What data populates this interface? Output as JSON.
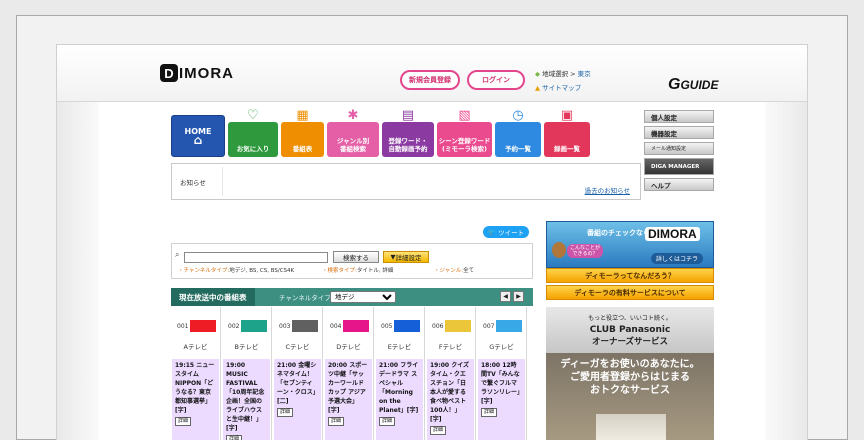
{
  "header": {
    "logo_text": "IMORA",
    "logo_d": "D",
    "signup_label": "新規会員登録",
    "login_label": "ログイン",
    "region_prefix": "地域選択 >",
    "region_value": "東京",
    "sitemap_label": "サイトマップ",
    "gguide_text": "GUIDE"
  },
  "nav": {
    "home": "HOME",
    "tabs": [
      {
        "label": "お気に入り",
        "color": "#2e9a3d"
      },
      {
        "label": "番組表",
        "color": "#ee8e00"
      },
      {
        "label": "ジャンル別\n番組検索",
        "color": "#e55fa6"
      },
      {
        "label": "登録ワード・\n自動録画予約",
        "color": "#8a3aa0"
      },
      {
        "label": "シーン登録ワード\n(ミモーラ検索)",
        "color": "#ea4a8e"
      },
      {
        "label": "予約一覧",
        "color": "#2e8ae0"
      },
      {
        "label": "録画一覧",
        "color": "#e2365a"
      }
    ],
    "right_buttons": [
      "個人設定",
      "機器設定",
      "メール通知設定",
      "DIGA MANAGER",
      "ヘルプ"
    ]
  },
  "news": {
    "label": "お知らせ",
    "past_link": "過去のお知らせ"
  },
  "tweet_label": "ツイート",
  "search": {
    "search_button": "検索する",
    "advanced_button": "詳細設定",
    "channel_type_label": "・チャンネルタイプ:",
    "channel_type_value": "地デジ, BS, CS, BS/CS4K",
    "search_type_label": "・検索タイプ:",
    "search_type_value": "タイトル, 詳細",
    "genre_label": "・ジャンル:",
    "genre_value": "全て"
  },
  "onair": {
    "title": "現在放送中の番組表",
    "channel_type_label": "チャンネルタイプ:",
    "channel_type_selected": "地デジ"
  },
  "channels": [
    {
      "num": "001",
      "name": "Aテレビ",
      "color": "#ee1c24",
      "program": "19:15 ニュースタイム NIPPON「どうなる？東京都知事選挙」[字]"
    },
    {
      "num": "002",
      "name": "Bテレビ",
      "color": "#1da38a",
      "program": "19:00 MUSIC FASTIVAL「10周年記念企画！全国のライブハウスと生中継！」[字]"
    },
    {
      "num": "003",
      "name": "Cテレビ",
      "color": "#606060",
      "program": "21:00 金曜シネマタイム！「セブンティーン・クロス」[二]"
    },
    {
      "num": "004",
      "name": "Dテレビ",
      "color": "#e6168a",
      "program": "20:00 スポーツ中継「サッカーワールドカップ アジア予選大会」[字]"
    },
    {
      "num": "005",
      "name": "Eテレビ",
      "color": "#1560d8",
      "program": "21:00 フライデードラマ スペシャル「Morning on the Planet」[字]"
    },
    {
      "num": "006",
      "name": "Fテレビ",
      "color": "#ebc53a",
      "program": "19:00 クイズタイム・クエスチョン「日本人が愛する食べ物ベスト100人！」[字]"
    },
    {
      "num": "007",
      "name": "Gテレビ",
      "color": "#38a8e6",
      "program": "18:00 12時間TV「みんなで繋ぐフルマラソンリレー」[字]"
    }
  ],
  "program_detail_label": "詳細",
  "right": {
    "ad_check": "番組のチェックなら",
    "ad_logo": "DIMORA",
    "ad_more": "詳しくはコチラ",
    "ad_bubble": "こんなことが\nできるの？",
    "orange1": "ディモーラってなんだろう？",
    "orange2": "ディモーラの有料サービスについて",
    "pana_line1": "もっと役立つ、いいコト続く。",
    "pana_line2": "CLUB Panasonic",
    "pana_line3": "オーナーズサービス",
    "diga_line1": "ディーガをお使いのあなたに。",
    "diga_line2": "ご愛用者登録からはじまる",
    "diga_line3": "おトクなサービス"
  }
}
